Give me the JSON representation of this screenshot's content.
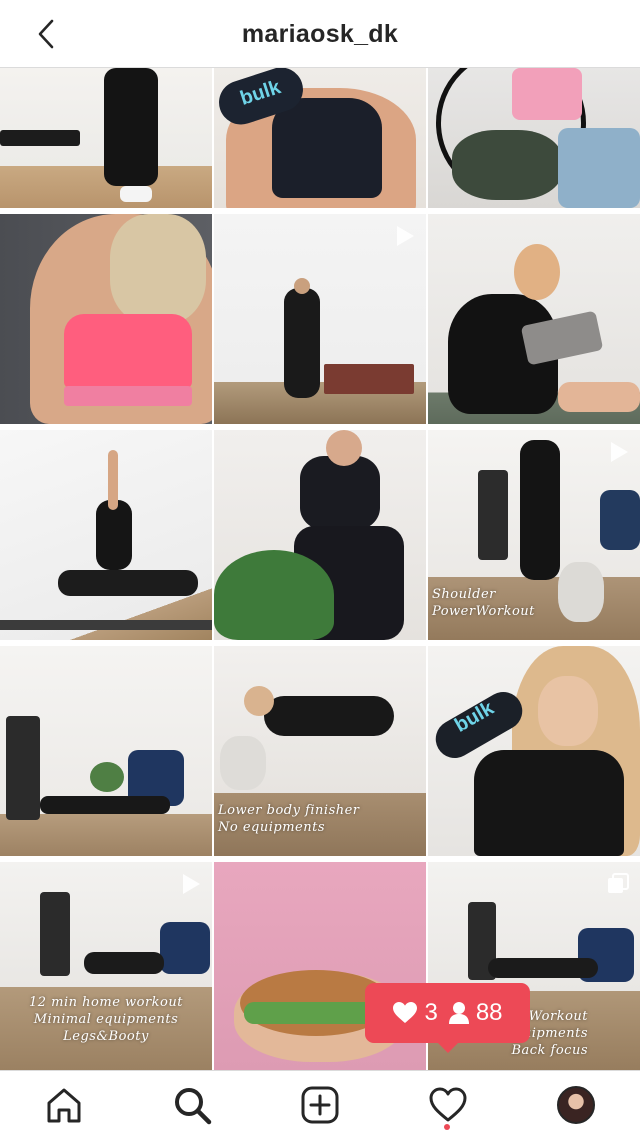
{
  "header": {
    "username": "mariaosk_dk",
    "back_icon": "chevron-left-icon"
  },
  "grid": {
    "tiles": [
      {
        "caption": "",
        "corner_icon": ""
      },
      {
        "caption": "",
        "corner_icon": "",
        "bottle_text": "bulk"
      },
      {
        "caption": "",
        "corner_icon": ""
      },
      {
        "caption": "",
        "corner_icon": ""
      },
      {
        "caption": "",
        "corner_icon": "video-icon"
      },
      {
        "caption": "",
        "corner_icon": ""
      },
      {
        "caption": "",
        "corner_icon": ""
      },
      {
        "caption": "",
        "corner_icon": ""
      },
      {
        "caption": "Shoulder\nPowerWorkout",
        "corner_icon": "video-icon"
      },
      {
        "caption": "",
        "corner_icon": ""
      },
      {
        "caption": "Lower body finisher\nNo equipments",
        "corner_icon": ""
      },
      {
        "caption": "",
        "corner_icon": "",
        "bottle_text": "bulk"
      },
      {
        "caption": "12 min home workout\nMinimal equipments\nLegs&Booty",
        "corner_icon": "video-icon"
      },
      {
        "caption": "",
        "corner_icon": ""
      },
      {
        "caption": "…Workout\nMinimal equipments\nBack focus",
        "corner_icon": "carousel-icon"
      }
    ]
  },
  "activity_popup": {
    "likes": "3",
    "followers": "88"
  },
  "tabbar": {
    "items": [
      "home-icon",
      "search-icon",
      "new-post-icon",
      "activity-heart-icon",
      "profile-avatar"
    ]
  },
  "colors": {
    "accent": "#ed4956",
    "text": "#262626",
    "border": "#dbdbdb"
  }
}
